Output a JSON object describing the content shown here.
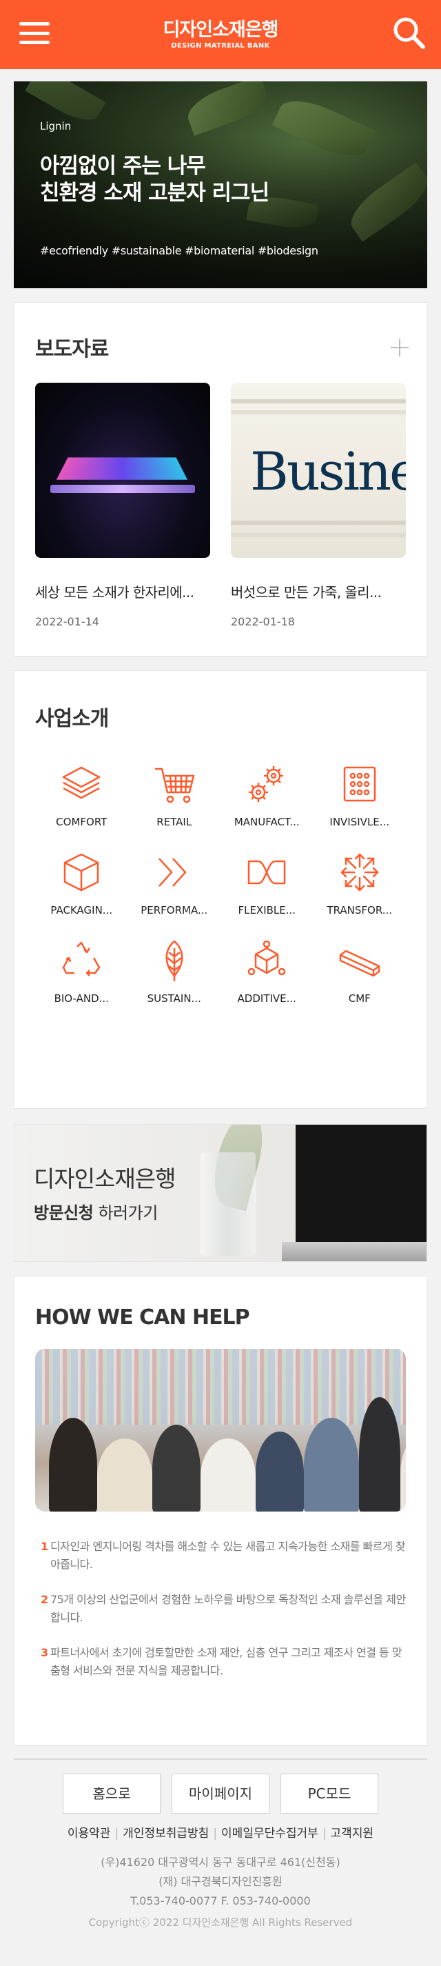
{
  "header": {
    "title": "디자인소재은행",
    "subtitle": "DESIGN MATREIAL BANK",
    "menu_icon": "hamburger-icon",
    "search_icon": "search-icon"
  },
  "hero": {
    "tag": "Lignin",
    "title_line1": "아낌없이 주는 나무",
    "title_line2": "친환경 소재 고분자 리그닌",
    "hashtags": "#ecofriendly #sustainable #biomaterial #biodesign"
  },
  "press": {
    "title": "보도자료",
    "items": [
      {
        "title": "세상 모든 소재가 한자리에...",
        "date": "2022-01-14"
      },
      {
        "title": "버섯으로 만든 가죽, 올리...",
        "date": "2022-01-18",
        "image_text": "Busine"
      }
    ]
  },
  "business": {
    "title": "사업소개",
    "accent": "#ff5a2c",
    "items": [
      {
        "label": "COMFORT",
        "icon": "layers-icon"
      },
      {
        "label": "RETAIL",
        "icon": "cart-icon"
      },
      {
        "label": "MANUFACT...",
        "icon": "gears-icon"
      },
      {
        "label": "INVISIVLE...",
        "icon": "circuit-icon"
      },
      {
        "label": "PACKAGIN...",
        "icon": "box-icon"
      },
      {
        "label": "PERFORMA...",
        "icon": "double-chevron-icon"
      },
      {
        "label": "FLEXIBLE...",
        "icon": "flex-icon"
      },
      {
        "label": "TRANSFOR...",
        "icon": "expand-arrows-icon"
      },
      {
        "label": "BIO-AND...",
        "icon": "recycle-icon"
      },
      {
        "label": "SUSTAIN...",
        "icon": "leaf-icon"
      },
      {
        "label": "ADDITIVE...",
        "icon": "molecule-cube-icon"
      },
      {
        "label": "CMF",
        "icon": "bar-icon"
      }
    ]
  },
  "visit": {
    "line1": "디자인소재은행",
    "line2_bold": "방문신청",
    "line2_rest": " 하러가기"
  },
  "help": {
    "title": "HOW WE CAN HELP",
    "items": [
      {
        "num": "1",
        "text": "디자인과 엔지니어링 격차를 해소할 수 있는 새롭고 지속가능한 소재를 빠르게 찾아줍니다."
      },
      {
        "num": "2",
        "text": "75개 이상의 산업군에서 경험한 노하우를 바탕으로 독창적인 소재 솔루션을 제안합니다."
      },
      {
        "num": "3",
        "text": "파트너사에서 초기에 검토할만한 소재 제안, 심층 연구 그리고 제조사 연결 등 맞춤형 서비스와 전문 지식을 제공합니다."
      }
    ]
  },
  "footer": {
    "buttons": [
      "홈으로",
      "마이페이지",
      "PC모드"
    ],
    "links": [
      "이용약관",
      "개인정보취급방침",
      "이메일무단수집거부",
      "고객지원"
    ],
    "address": "(우)41620 대구광역시 동구 동대구로 461(신천동)",
    "org": "(재) 대구경북디자인진흥원",
    "contact": "T.053-740-0077 F. 053-740-0000",
    "copyright": "Copyrightⓒ 2022 디자인소재은행 All Rights Reserved"
  }
}
